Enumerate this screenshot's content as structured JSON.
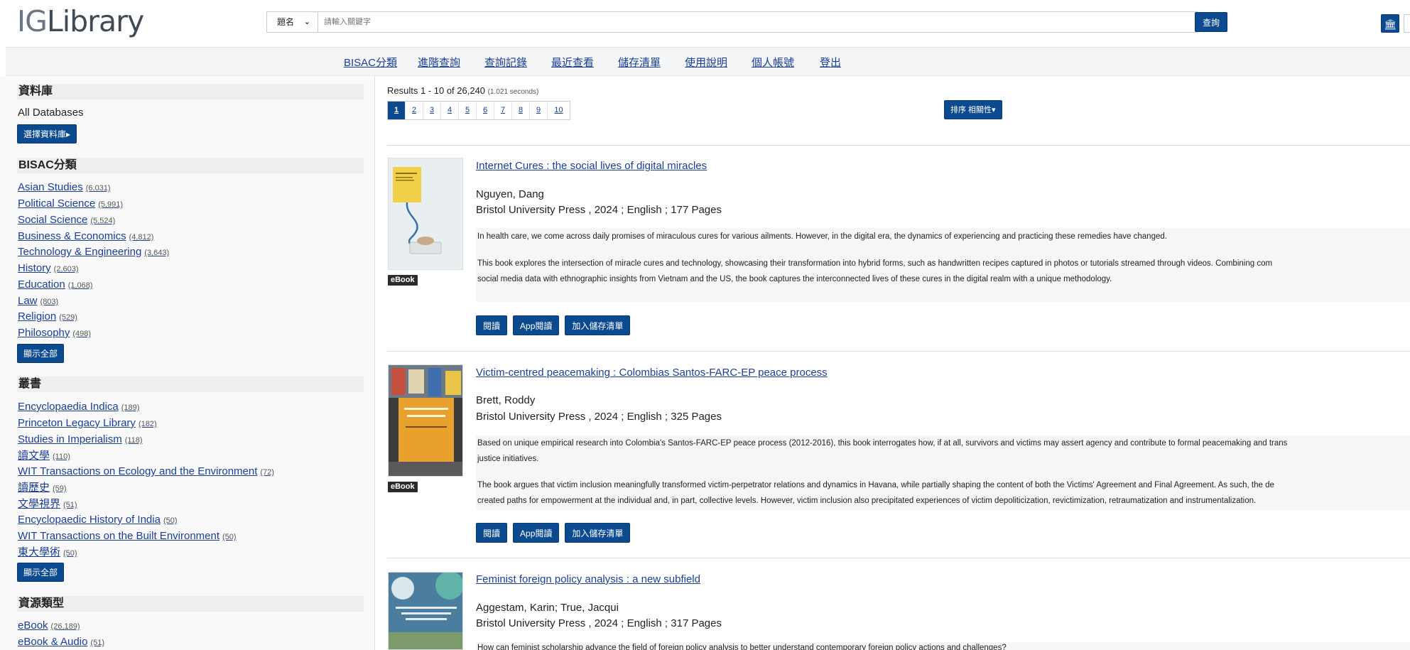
{
  "header": {
    "logo_prefix": "IG",
    "logo_main": "Library",
    "search_type": "題名",
    "search_placeholder": "請輸入關鍵字",
    "search_button": "查詢",
    "library_icon": "bank-icon"
  },
  "nav": [
    "BISAC分類",
    "進階查詢",
    "查詢記錄",
    "最近查看",
    "儲存清單",
    "使用說明",
    "個人帳號",
    "登出"
  ],
  "sidebar": {
    "db_heading": "資料庫",
    "db_value": "All Databases",
    "db_button": "選擇資料庫▸",
    "bisac_heading": "BISAC分類",
    "bisac_items": [
      {
        "label": "Asian Studies",
        "count": "(6,031)"
      },
      {
        "label": "Political Science",
        "count": "(5,991)"
      },
      {
        "label": "Social Science",
        "count": "(5,524)"
      },
      {
        "label": "Business & Economics",
        "count": "(4,812)"
      },
      {
        "label": "Technology & Engineering",
        "count": "(3,643)"
      },
      {
        "label": "History",
        "count": "(2,603)"
      },
      {
        "label": "Education",
        "count": "(1,068)"
      },
      {
        "label": "Law",
        "count": "(803)"
      },
      {
        "label": "Religion",
        "count": "(529)"
      },
      {
        "label": "Philosophy",
        "count": "(498)"
      }
    ],
    "bisac_button": "顯示全部",
    "series_heading": "叢書",
    "series_items": [
      {
        "label": "Encyclopaedia Indica",
        "count": "(189)"
      },
      {
        "label": "Princeton Legacy Library",
        "count": "(182)"
      },
      {
        "label": "Studies in Imperialism",
        "count": "(118)"
      },
      {
        "label": "讀文學",
        "count": "(110)"
      },
      {
        "label": "WIT Transactions on Ecology and the Environment",
        "count": "(72)"
      },
      {
        "label": "讀歷史",
        "count": "(59)"
      },
      {
        "label": "文學視界",
        "count": "(51)"
      },
      {
        "label": "Encyclopaedic History of India",
        "count": "(50)"
      },
      {
        "label": "WIT Transactions on the Built Environment",
        "count": "(50)"
      },
      {
        "label": "東大學術",
        "count": "(50)"
      }
    ],
    "series_button": "顯示全部",
    "type_heading": "資源類型",
    "type_items": [
      {
        "label": "eBook",
        "count": "(26,189)"
      },
      {
        "label": "eBook & Audio",
        "count": "(51)"
      }
    ]
  },
  "results": {
    "count_text": "Results 1 - 10 of 26,240",
    "seconds": "(1.021 seconds)",
    "pages": [
      "1",
      "2",
      "3",
      "4",
      "5",
      "6",
      "7",
      "8",
      "9",
      "10"
    ],
    "current_page": "1",
    "sort_label": "排序 相關性▾",
    "badge": "eBook",
    "read_label": "閱讀",
    "app_read_label": "App閱讀",
    "save_label": "加入儲存清單",
    "items": [
      {
        "title": "Internet Cures : the social lives of digital miracles",
        "author": "Nguyen, Dang",
        "pub": "Bristol University Press , 2024 ; English ; 177 Pages",
        "desc1": "In health care, we come across daily promises of miraculous cures for various ailments. However, in the digital era, the dynamics of experiencing and practicing these remedies have changed.",
        "desc2": "This book explores the intersection of miracle cures and technology, showcasing their transformation into hybrid forms, such as handwritten recipes captured in photos or tutorials streamed through videos. Combining com",
        "desc3": "social media data with ethnographic insights from Vietnam and the US, the book captures the interconnected lives of these cures in the digital realm with a unique methodology."
      },
      {
        "title": "Victim-centred peacemaking : Colombias Santos-FARC-EP peace process",
        "author": "Brett, Roddy",
        "pub": "Bristol University Press , 2024 ; English ; 325 Pages",
        "desc1": "Based on unique empirical research into Colombia's Santos-FARC-EP peace process (2012-2016), this book interrogates how, if at all, survivors and victims may assert agency and contribute to formal peacemaking and trans",
        "desc2": "justice initiatives.",
        "desc3": "The book argues that victim inclusion meaningfully transformed victim-perpetrator relations and dynamics in Havana, while partially shaping the content of both the Victims' Agreement and Final Agreement. As such, the de",
        "desc4": "created paths for empowerment at the individual and, in part, collective levels. However, victim inclusion also precipitated experiences of victim depoliticization, revictimization, retraumatization and instrumentalization."
      },
      {
        "title": "Feminist foreign policy analysis : a new subfield",
        "author": "Aggestam, Karin; True, Jacqui",
        "pub": "Bristol University Press , 2024 ; English ; 317 Pages",
        "desc1": "How can feminist scholarship advance the field of foreign policy analysis to better understand contemporary foreign policy actions and challenges?"
      }
    ]
  },
  "colors": {
    "primary": "#0b4a8f",
    "link": "#1a3e9c",
    "sidebar_bg": "#f9f9fa",
    "navbar_bg": "#f4f5f6"
  }
}
